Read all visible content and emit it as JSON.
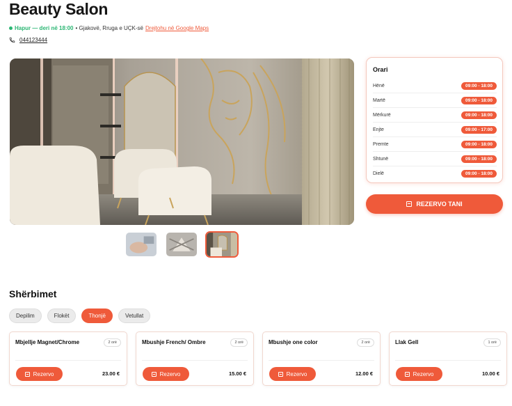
{
  "header": {
    "title": "Beauty Salon",
    "open_status": "Hapur — deri në 18:00",
    "address": "• Gjakovë, Rruga e UÇK-së",
    "maps_link": "Drejtohu në Google Maps",
    "phone": "044123444"
  },
  "schedule": {
    "title": "Orari",
    "rows": [
      {
        "day": "Hënë",
        "hours": "09:00 - 18:00"
      },
      {
        "day": "Martë",
        "hours": "09:00 - 18:00"
      },
      {
        "day": "Mërkurë",
        "hours": "09:00 - 18:00"
      },
      {
        "day": "Enjte",
        "hours": "09:00 - 17:00"
      },
      {
        "day": "Premte",
        "hours": "09:00 - 18:00"
      },
      {
        "day": "Shtunë",
        "hours": "09:00 - 18:00"
      },
      {
        "day": "Dielë",
        "hours": "09:00 - 18:00"
      }
    ]
  },
  "reserve_button": "REZERVO TANI",
  "services": {
    "title": "Shërbimet",
    "categories": [
      "Depilim",
      "Flokët",
      "Thonjë",
      "Vetullat"
    ],
    "active_category": "Thonjë",
    "items": [
      {
        "name": "Mbjellje Magnet/Chrome",
        "duration": "2 orë",
        "price": "23.00 €",
        "button": "Rezervo"
      },
      {
        "name": "Mbushje French/ Ombre",
        "duration": "2 orë",
        "price": "15.00 €",
        "button": "Rezervo"
      },
      {
        "name": "Mbushje one color",
        "duration": "2 orë",
        "price": "12.00 €",
        "button": "Rezervo"
      },
      {
        "name": "Llak Gell",
        "duration": "1 orë",
        "price": "10.00 €",
        "button": "Rezervo"
      }
    ]
  },
  "colors": {
    "accent": "#ef5a3a",
    "open": "#2bb673"
  },
  "icons": {
    "status": "status-dot-icon",
    "phone": "phone-icon",
    "calendar": "calendar-icon"
  }
}
